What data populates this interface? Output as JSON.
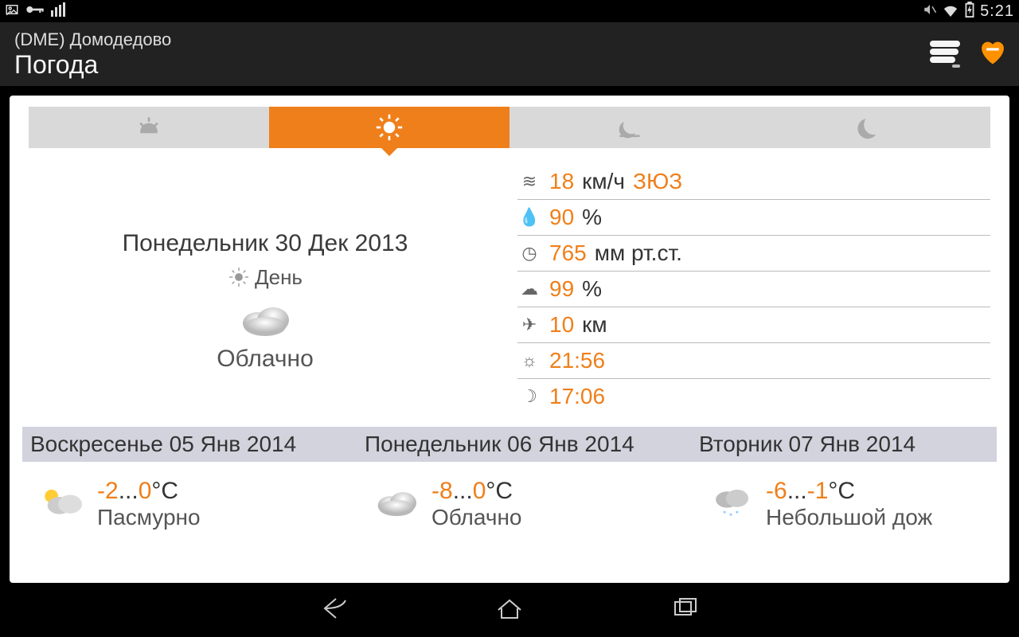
{
  "status": {
    "time": "5:21"
  },
  "header": {
    "subtitle": "(DME) Домодедово",
    "title": "Погода"
  },
  "current": {
    "date": "Понедельник 30 Дек 2013",
    "daypart_label": "День",
    "condition": "Облачно",
    "wind_speed": "18",
    "wind_unit": "км/ч",
    "wind_dir": "ЗЮЗ",
    "humidity": "90",
    "humidity_unit": "%",
    "pressure": "765",
    "pressure_unit": "мм рт.ст.",
    "cloud": "99",
    "cloud_unit": "%",
    "visibility": "10",
    "visibility_unit": "км",
    "sunrise": "21:56",
    "sunset": "17:06"
  },
  "forecast": [
    {
      "title": "Воскресенье 05 Янв 2014",
      "low": "-2",
      "high": "0",
      "unit": "°C",
      "desc": "Пасмурно",
      "icon": "partly"
    },
    {
      "title": "Понедельник 06 Янв 2014",
      "low": "-8",
      "high": "0",
      "unit": "°C",
      "desc": "Облачно",
      "icon": "cloud"
    },
    {
      "title": "Вторник 07 Янв 2014",
      "low": "-6",
      "high": "-1",
      "unit": "°C",
      "desc": "Небольшой дож",
      "icon": "snow"
    }
  ]
}
